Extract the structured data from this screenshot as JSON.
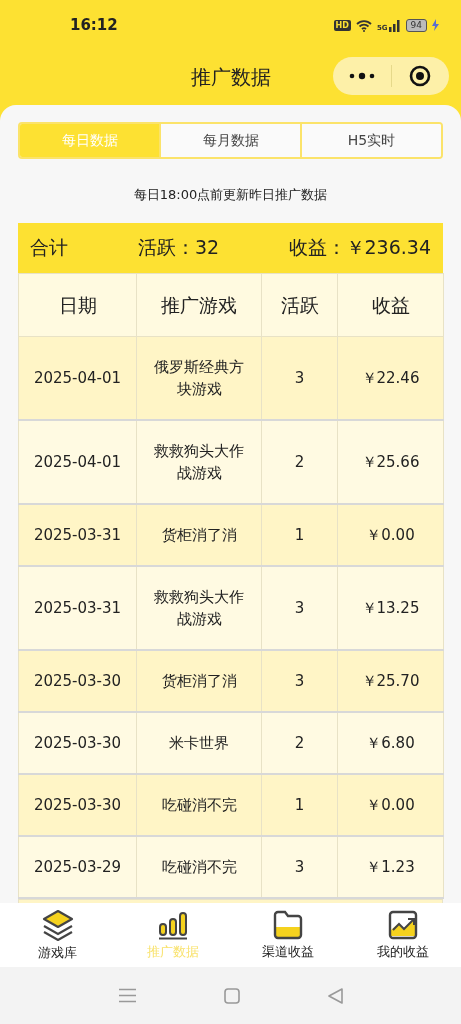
{
  "status_bar": {
    "time": "16:12",
    "hd": "HD",
    "network": "5G",
    "battery": "94",
    "charging": true
  },
  "header": {
    "title": "推广数据"
  },
  "tabs": [
    {
      "label": "每日数据",
      "selected": true
    },
    {
      "label": "每月数据",
      "selected": false
    },
    {
      "label": "H5实时",
      "selected": false
    }
  ],
  "notice": "每日18:00点前更新昨日推广数据",
  "summary": {
    "label": "合计",
    "active": "活跃：32",
    "income": "收益：￥236.34"
  },
  "table": {
    "columns": [
      "日期",
      "推广游戏",
      "活跃",
      "收益"
    ],
    "rows": [
      [
        "2025-04-01",
        "俄罗斯经典方块游戏",
        "3",
        "￥22.46"
      ],
      [
        "2025-04-01",
        "救救狗头大作战游戏",
        "2",
        "￥25.66"
      ],
      [
        "2025-03-31",
        "货柜消了消",
        "1",
        "￥0.00"
      ],
      [
        "2025-03-31",
        "救救狗头大作战游戏",
        "3",
        "￥13.25"
      ],
      [
        "2025-03-30",
        "货柜消了消",
        "3",
        "￥25.70"
      ],
      [
        "2025-03-30",
        "米卡世界",
        "2",
        "￥6.80"
      ],
      [
        "2025-03-30",
        "吃碰消不完",
        "1",
        "￥0.00"
      ],
      [
        "2025-03-29",
        "吃碰消不完",
        "3",
        "￥1.23"
      ]
    ]
  },
  "tab_bar": [
    {
      "label": "游戏库",
      "kind": "layers",
      "selected": false
    },
    {
      "label": "推广数据",
      "kind": "bars",
      "selected": true
    },
    {
      "label": "渠道收益",
      "kind": "folder",
      "selected": false
    },
    {
      "label": "我的收益",
      "kind": "trend",
      "selected": false
    }
  ]
}
